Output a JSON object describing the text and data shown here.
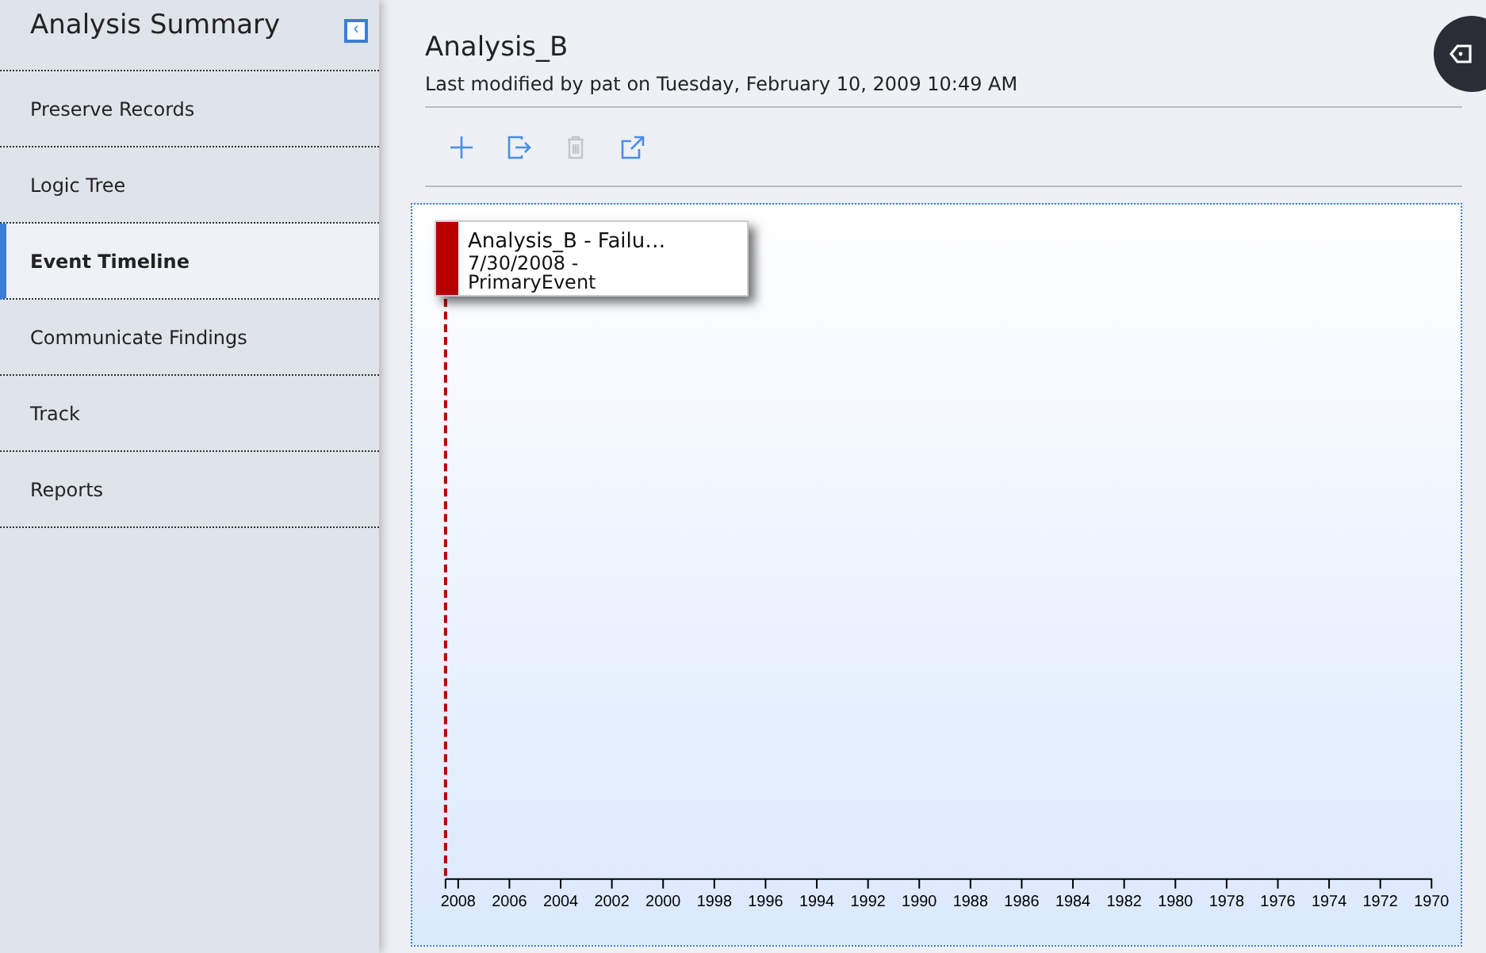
{
  "sidebar": {
    "title": "Analysis Summary",
    "collapse_icon": "‹",
    "items": [
      {
        "label": "Preserve Records",
        "selected": false
      },
      {
        "label": "Logic Tree",
        "selected": false
      },
      {
        "label": "Event Timeline",
        "selected": true
      },
      {
        "label": "Communicate Findings",
        "selected": false
      },
      {
        "label": "Track",
        "selected": false
      },
      {
        "label": "Reports",
        "selected": false
      }
    ]
  },
  "header": {
    "title": "Analysis_B",
    "subtitle": "Last modified by pat on Tuesday, February 10, 2009 10:49 AM"
  },
  "toolbar": [
    {
      "kind": "add",
      "disabled": false
    },
    {
      "kind": "export",
      "disabled": false
    },
    {
      "kind": "delete",
      "disabled": true
    },
    {
      "kind": "open",
      "disabled": false
    }
  ],
  "timeline": {
    "events": [
      {
        "title": "Analysis_B - Failu…",
        "date": "7/30/2008 -",
        "type": "PrimaryEvent",
        "color": "#b80000"
      }
    ],
    "axis_labels": [
      "2008",
      "2006",
      "2004",
      "2002",
      "2000",
      "1998",
      "1996",
      "1994",
      "1992",
      "1990",
      "1988",
      "1986",
      "1984",
      "1982",
      "1980",
      "1978",
      "1976",
      "1974",
      "1972",
      "1970"
    ]
  }
}
